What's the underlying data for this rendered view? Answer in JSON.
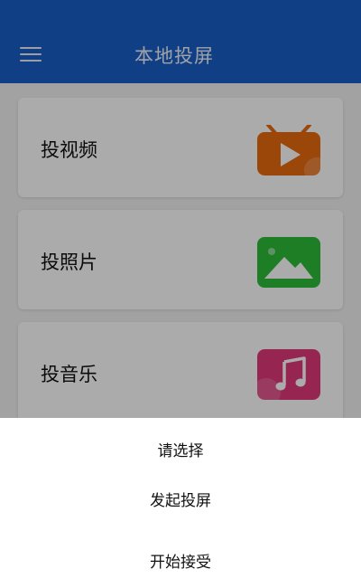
{
  "header": {
    "title": "本地投屏",
    "menu_icon": "hamburger-menu-icon",
    "color": "#1a5fc7"
  },
  "items": [
    {
      "label": "投视频",
      "icon": "tv-play-icon",
      "color": "#e96a10"
    },
    {
      "label": "投照片",
      "icon": "image-icon",
      "color": "#2dbd3a"
    },
    {
      "label": "投音乐",
      "icon": "music-note-icon",
      "color": "#e03a7a"
    }
  ],
  "dialog": {
    "title": "请选择",
    "options": [
      "发起投屏",
      "开始接受"
    ]
  }
}
